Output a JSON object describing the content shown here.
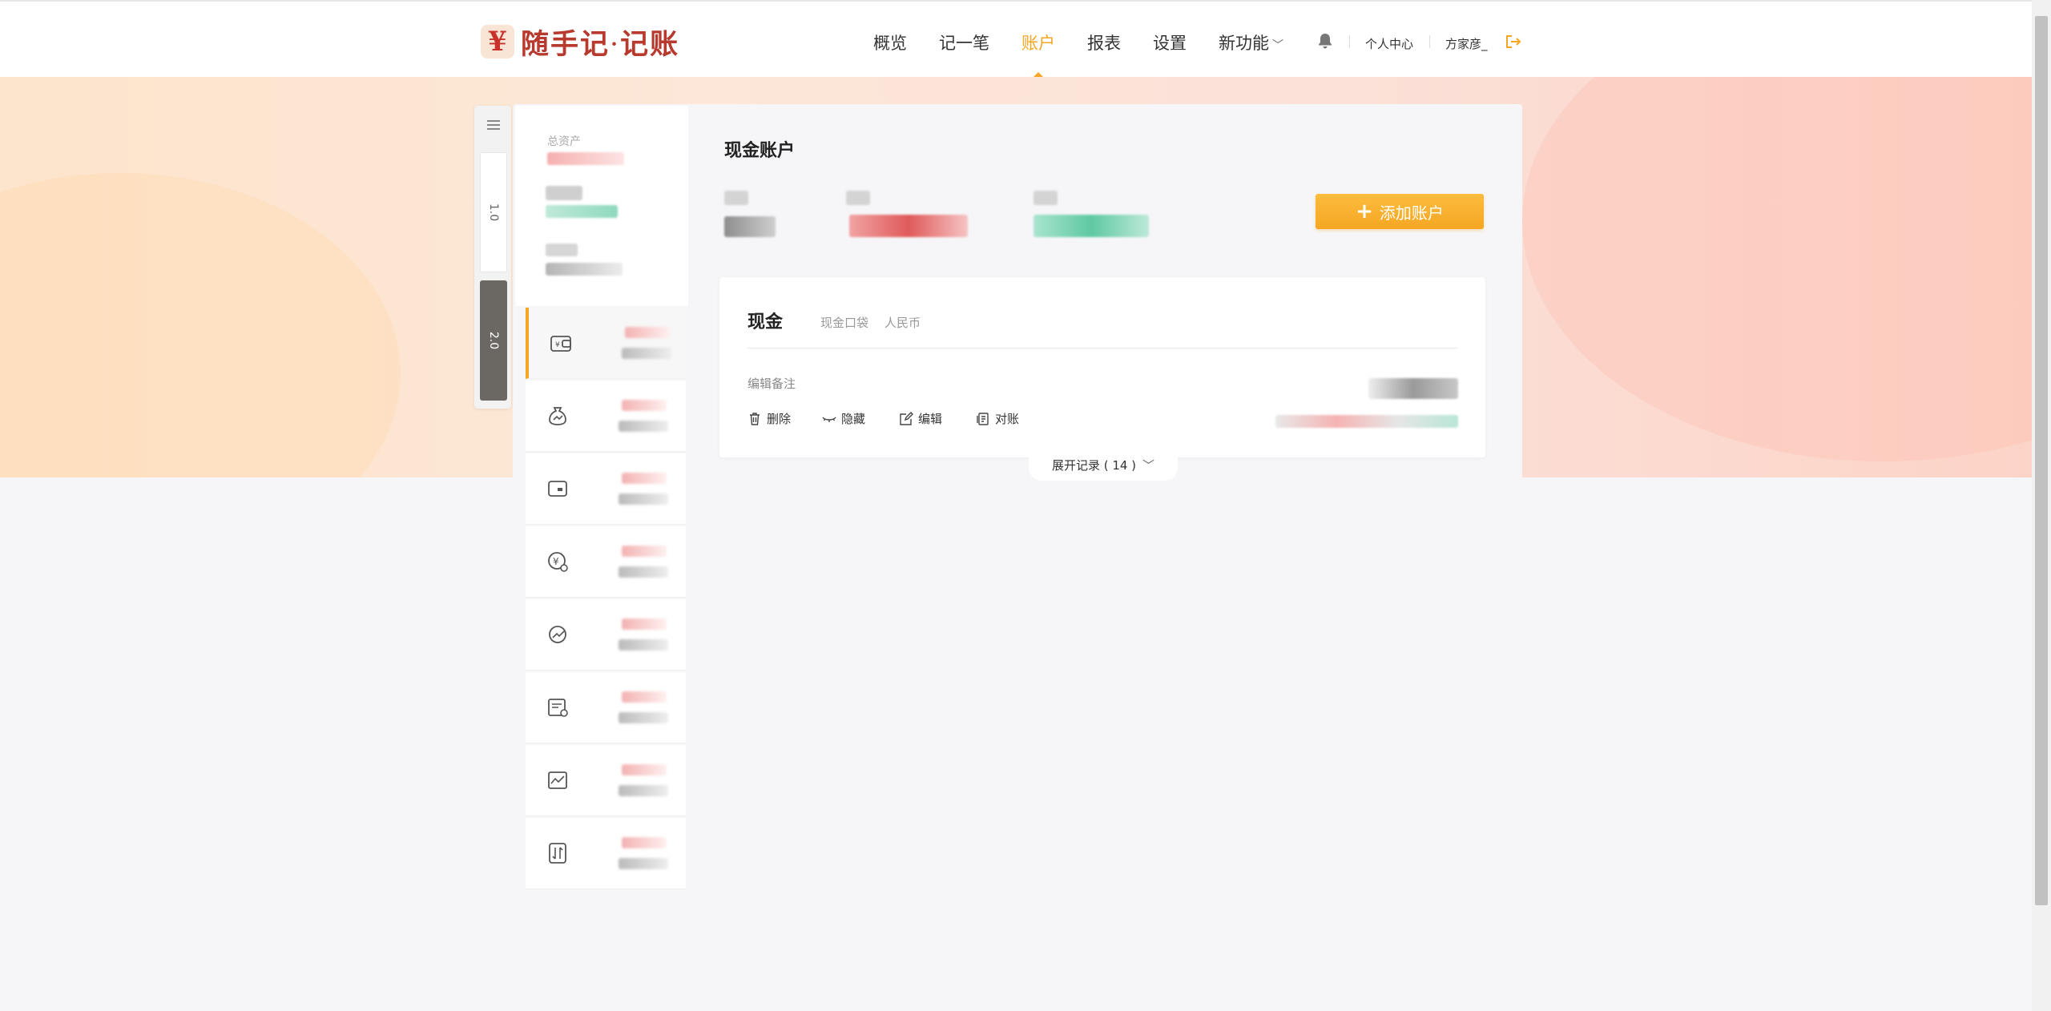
{
  "app": {
    "logo_mark": "¥",
    "logo_name": "随手记",
    "logo_dot": "·",
    "logo_suffix": "记账"
  },
  "nav": [
    {
      "label": "概览"
    },
    {
      "label": "记一笔"
    },
    {
      "label": "账户",
      "active": true
    },
    {
      "label": "报表"
    },
    {
      "label": "设置"
    },
    {
      "label": "新功能",
      "has_dropdown": true
    }
  ],
  "header": {
    "notification_icon": "bell-icon",
    "personal_center": "个人中心",
    "username": "方家彦_",
    "logout_icon": "logout-icon"
  },
  "version_switch": {
    "v1": "1.0",
    "v2": "2.0"
  },
  "sidebar": {
    "total_label": "总资产",
    "items": [
      {
        "icon": "wallet-icon",
        "active": true
      },
      {
        "icon": "money-bag-icon"
      },
      {
        "icon": "card-icon"
      },
      {
        "icon": "yuan-coin-icon"
      },
      {
        "icon": "investment-icon"
      },
      {
        "icon": "receivable-icon"
      },
      {
        "icon": "stock-chart-icon"
      },
      {
        "icon": "transfer-icon"
      }
    ]
  },
  "main": {
    "title": "现金账户",
    "add_account": "添加账户",
    "account": {
      "name": "现金",
      "tags": [
        "现金口袋",
        "人民币"
      ],
      "note": "编辑备注",
      "actions": [
        "删除",
        "隐藏",
        "编辑",
        "对账"
      ],
      "expand_label": "展开记录 ( 14 )"
    }
  },
  "colors": {
    "accent": "#f5a623",
    "brand": "#b83a2e"
  }
}
